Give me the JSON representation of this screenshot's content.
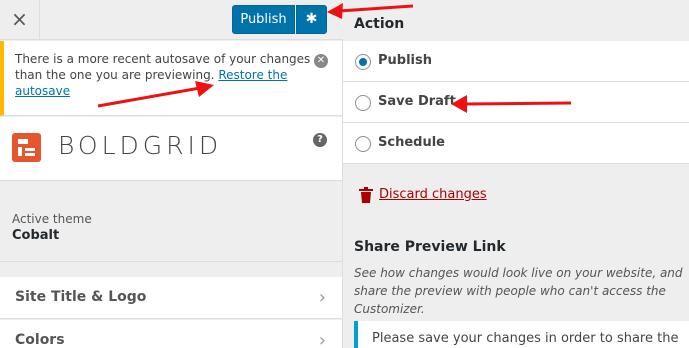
{
  "topbar": {
    "close_label": "×",
    "publish_label": "Publish",
    "settings_icon": "gear-icon"
  },
  "notice": {
    "text": "There is a more recent autosave of your changes than the one you are previewing. ",
    "link": "Restore the autosave",
    "close_icon": "close-icon"
  },
  "brand": {
    "logo_text": "BOLDGRID",
    "help_icon": "help-icon",
    "accent": "#e4572e"
  },
  "theme": {
    "label": "Active theme",
    "name": "Cobalt"
  },
  "sections": [
    {
      "label": "Site Title & Logo"
    },
    {
      "label": "Colors"
    }
  ],
  "action": {
    "title": "Action",
    "options": [
      {
        "label": "Publish",
        "checked": true
      },
      {
        "label": "Save Draft",
        "checked": false
      },
      {
        "label": "Schedule",
        "checked": false
      }
    ]
  },
  "discard": {
    "label": "Discard changes",
    "icon": "trash-icon"
  },
  "share": {
    "title": "Share Preview Link",
    "description": "See how changes would look live on your website, and share the preview with people who can't access the Customizer.",
    "notice": "Please save your changes in order to share the"
  },
  "colors": {
    "primary": "#0073aa",
    "warning": "#ffb900",
    "danger": "#a00",
    "annotation": "#e11"
  }
}
